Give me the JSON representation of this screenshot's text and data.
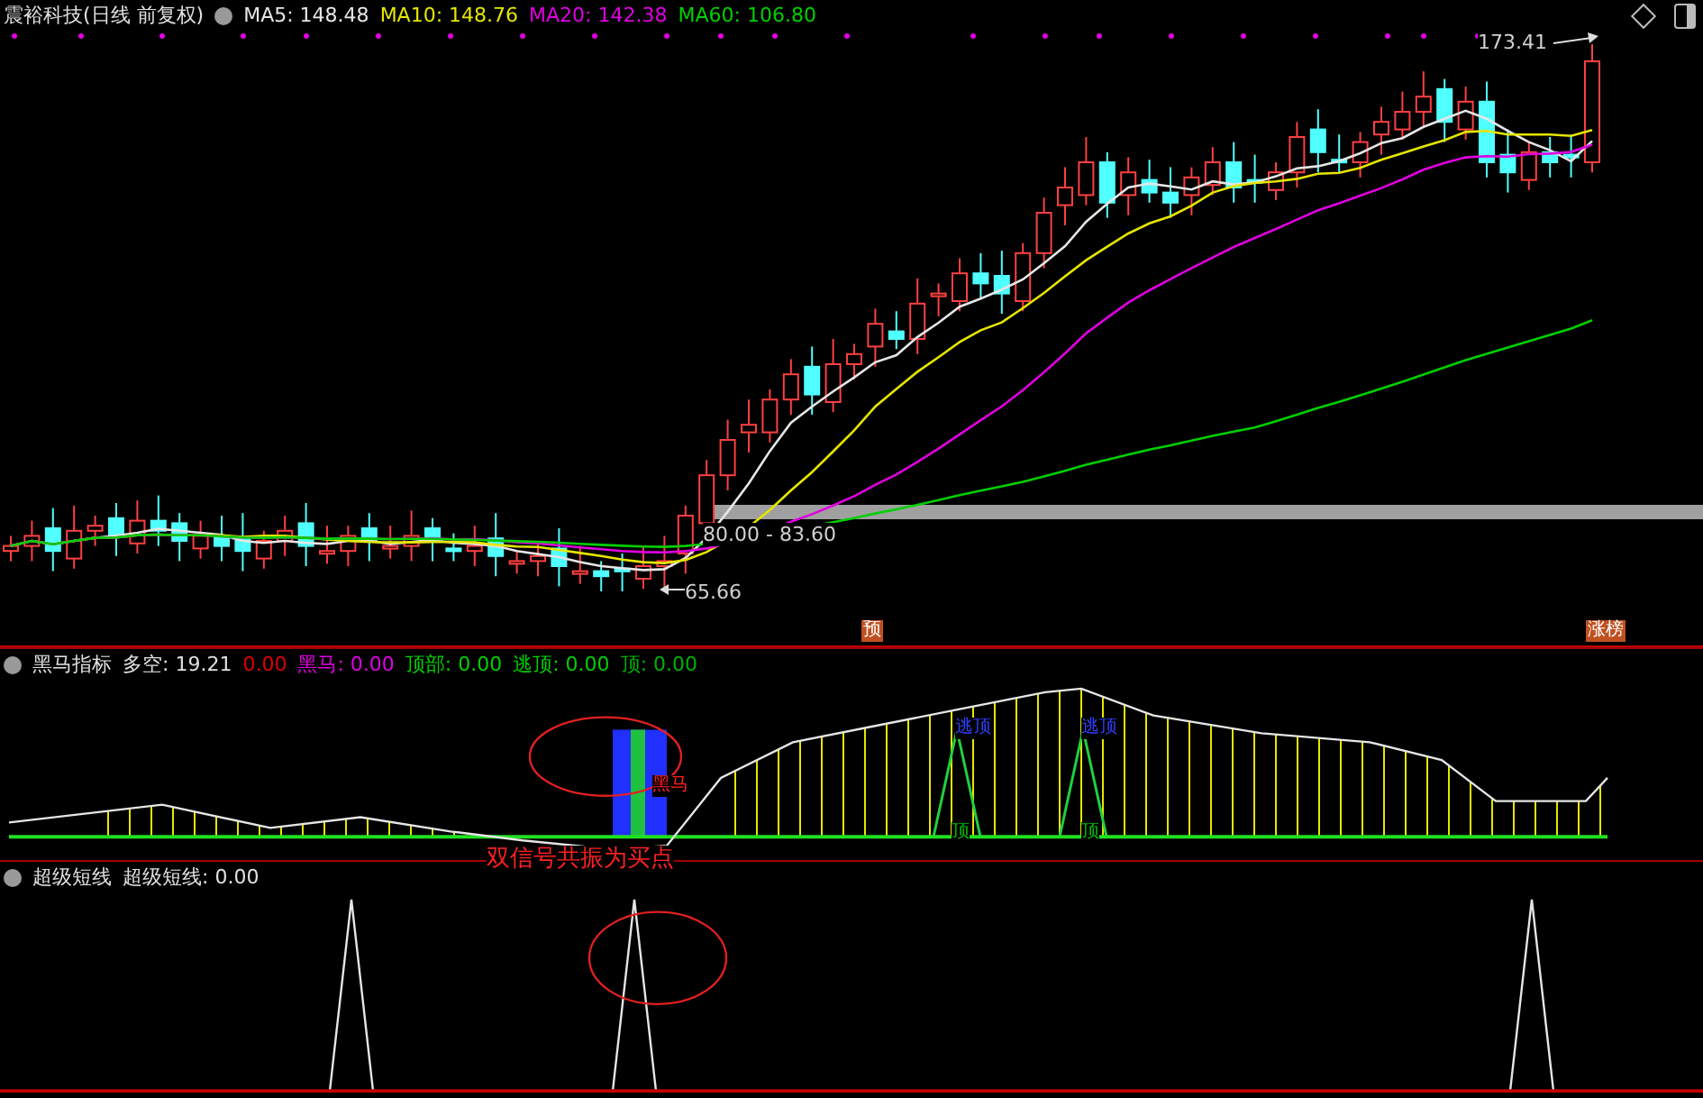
{
  "header": {
    "stock_name": "震裕科技",
    "period": "(日线 前复权)",
    "legend": [
      {
        "label": "MA5: 148.48",
        "color": "#e6e6e6"
      },
      {
        "label": "MA10: 148.76",
        "color": "#e6e600"
      },
      {
        "label": "MA20: 142.38",
        "color": "#e000e0"
      },
      {
        "label": "MA60: 106.80",
        "color": "#00d000"
      }
    ]
  },
  "price_chart": {
    "gap_label": "80.00 - 83.60",
    "low_label": "65.66",
    "high_label": "173.41"
  },
  "markers": [
    {
      "label": "预"
    },
    {
      "label": "涨榜"
    }
  ],
  "indicator": {
    "name": "黑马指标",
    "values": [
      {
        "label": "多空: 19.21",
        "color": "#e0e0e0"
      },
      {
        "label": "0.00",
        "color": "#e00000"
      },
      {
        "label": "黑马: 0.00",
        "color": "#e000e0"
      },
      {
        "label": "顶部: 0.00",
        "color": "#00d000"
      },
      {
        "label": "逃顶: 0.00",
        "color": "#00d000"
      },
      {
        "label": "顶: 0.00",
        "color": "#00b000"
      }
    ],
    "annotations": [
      {
        "text": "黑马",
        "color": "#ff2020"
      },
      {
        "text": "逃顶",
        "color": "#3040ff"
      },
      {
        "text": "逃顶",
        "color": "#3040ff"
      },
      {
        "text": "顶",
        "color": "#00c000"
      },
      {
        "text": "顶",
        "color": "#00c000"
      }
    ]
  },
  "short_line": {
    "name": "超级短线",
    "values": [
      {
        "label": "超级短线: 0.00",
        "color": "#e0e0e0"
      }
    ]
  },
  "callout": "双信号共振为买点"
}
